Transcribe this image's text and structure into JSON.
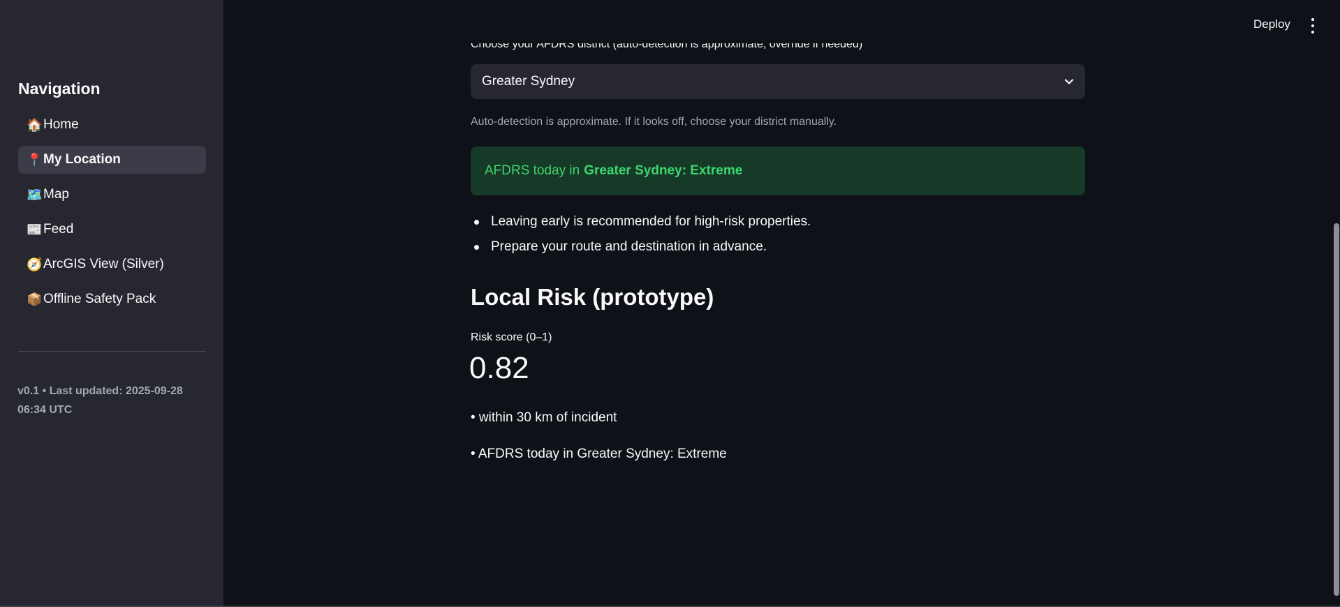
{
  "header": {
    "deploy_label": "Deploy"
  },
  "sidebar": {
    "title": "Navigation",
    "items": [
      {
        "icon": "🏠",
        "icon_name": "house-icon",
        "label": "Home",
        "active": false
      },
      {
        "icon": "📍",
        "icon_name": "pin-icon",
        "label": "My Location",
        "active": true
      },
      {
        "icon": "🗺️",
        "icon_name": "map-icon",
        "label": "Map",
        "active": false
      },
      {
        "icon": "📰",
        "icon_name": "newspaper-icon",
        "label": "Feed",
        "active": false
      },
      {
        "icon": "🧭",
        "icon_name": "compass-icon",
        "label": "ArcGIS View (Silver)",
        "active": false
      },
      {
        "icon": "📦",
        "icon_name": "package-icon",
        "label": "Offline Safety Pack",
        "active": false
      }
    ],
    "version_text": "v0.1 • Last updated: 2025-09-28 06:34 UTC"
  },
  "main": {
    "district_select": {
      "label": "Choose your AFDRS district (auto-detection is approximate; override if needed)",
      "value": "Greater Sydney"
    },
    "help_text": "Auto-detection is approximate. If it looks off, choose your district manually.",
    "alert": {
      "prefix": "AFDRS today in",
      "bold": "Greater Sydney: Extreme",
      "color": "#3dd56d",
      "background": "#173928"
    },
    "bullets": [
      "Leaving early is recommended for high-risk properties.",
      "Prepare your route and destination in advance."
    ],
    "section_title": "Local Risk (prototype)",
    "metric": {
      "label": "Risk score (0–1)",
      "value": "0.82"
    },
    "risk_lines": [
      "• within 30 km of incident",
      "• AFDRS today in Greater Sydney: Extreme"
    ]
  }
}
